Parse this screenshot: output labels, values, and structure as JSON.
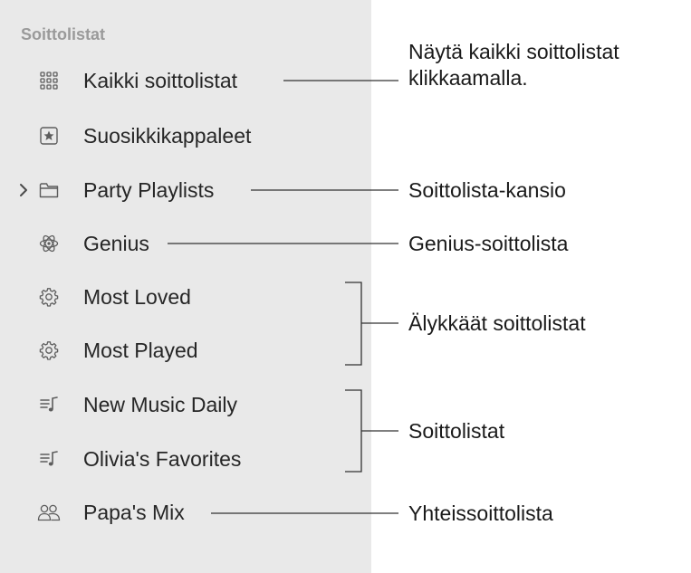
{
  "sidebar": {
    "section_title": "Soittolistat",
    "items": [
      {
        "label": "Kaikki soittolistat",
        "icon": "grid-icon"
      },
      {
        "label": "Suosikkikappaleet",
        "icon": "star-box-icon"
      },
      {
        "label": "Party Playlists",
        "icon": "folder-icon",
        "expandable": true
      },
      {
        "label": "Genius",
        "icon": "atom-icon"
      },
      {
        "label": "Most Loved",
        "icon": "gear-icon"
      },
      {
        "label": "Most Played",
        "icon": "gear-icon"
      },
      {
        "label": "New Music Daily",
        "icon": "playlist-icon"
      },
      {
        "label": "Olivia's Favorites",
        "icon": "playlist-icon"
      },
      {
        "label": "Papa's Mix",
        "icon": "people-icon"
      }
    ]
  },
  "callouts": {
    "all_playlists_line1": "Näytä kaikki soittolistat",
    "all_playlists_line2": "klikkaamalla.",
    "folder": "Soittolista-kansio",
    "genius": "Genius-soittolista",
    "smart": "Älykkäät soittolistat",
    "playlists": "Soittolistat",
    "collaborative": "Yhteissoittolista"
  }
}
